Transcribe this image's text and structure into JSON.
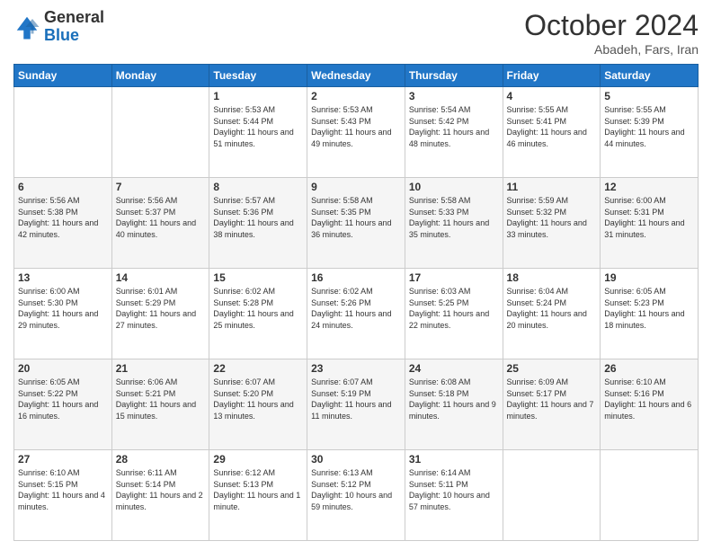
{
  "logo": {
    "general": "General",
    "blue": "Blue"
  },
  "header": {
    "month": "October 2024",
    "location": "Abadeh, Fars, Iran"
  },
  "weekdays": [
    "Sunday",
    "Monday",
    "Tuesday",
    "Wednesday",
    "Thursday",
    "Friday",
    "Saturday"
  ],
  "weeks": [
    [
      {
        "day": "",
        "info": ""
      },
      {
        "day": "",
        "info": ""
      },
      {
        "day": "1",
        "info": "Sunrise: 5:53 AM\nSunset: 5:44 PM\nDaylight: 11 hours and 51 minutes."
      },
      {
        "day": "2",
        "info": "Sunrise: 5:53 AM\nSunset: 5:43 PM\nDaylight: 11 hours and 49 minutes."
      },
      {
        "day": "3",
        "info": "Sunrise: 5:54 AM\nSunset: 5:42 PM\nDaylight: 11 hours and 48 minutes."
      },
      {
        "day": "4",
        "info": "Sunrise: 5:55 AM\nSunset: 5:41 PM\nDaylight: 11 hours and 46 minutes."
      },
      {
        "day": "5",
        "info": "Sunrise: 5:55 AM\nSunset: 5:39 PM\nDaylight: 11 hours and 44 minutes."
      }
    ],
    [
      {
        "day": "6",
        "info": "Sunrise: 5:56 AM\nSunset: 5:38 PM\nDaylight: 11 hours and 42 minutes."
      },
      {
        "day": "7",
        "info": "Sunrise: 5:56 AM\nSunset: 5:37 PM\nDaylight: 11 hours and 40 minutes."
      },
      {
        "day": "8",
        "info": "Sunrise: 5:57 AM\nSunset: 5:36 PM\nDaylight: 11 hours and 38 minutes."
      },
      {
        "day": "9",
        "info": "Sunrise: 5:58 AM\nSunset: 5:35 PM\nDaylight: 11 hours and 36 minutes."
      },
      {
        "day": "10",
        "info": "Sunrise: 5:58 AM\nSunset: 5:33 PM\nDaylight: 11 hours and 35 minutes."
      },
      {
        "day": "11",
        "info": "Sunrise: 5:59 AM\nSunset: 5:32 PM\nDaylight: 11 hours and 33 minutes."
      },
      {
        "day": "12",
        "info": "Sunrise: 6:00 AM\nSunset: 5:31 PM\nDaylight: 11 hours and 31 minutes."
      }
    ],
    [
      {
        "day": "13",
        "info": "Sunrise: 6:00 AM\nSunset: 5:30 PM\nDaylight: 11 hours and 29 minutes."
      },
      {
        "day": "14",
        "info": "Sunrise: 6:01 AM\nSunset: 5:29 PM\nDaylight: 11 hours and 27 minutes."
      },
      {
        "day": "15",
        "info": "Sunrise: 6:02 AM\nSunset: 5:28 PM\nDaylight: 11 hours and 25 minutes."
      },
      {
        "day": "16",
        "info": "Sunrise: 6:02 AM\nSunset: 5:26 PM\nDaylight: 11 hours and 24 minutes."
      },
      {
        "day": "17",
        "info": "Sunrise: 6:03 AM\nSunset: 5:25 PM\nDaylight: 11 hours and 22 minutes."
      },
      {
        "day": "18",
        "info": "Sunrise: 6:04 AM\nSunset: 5:24 PM\nDaylight: 11 hours and 20 minutes."
      },
      {
        "day": "19",
        "info": "Sunrise: 6:05 AM\nSunset: 5:23 PM\nDaylight: 11 hours and 18 minutes."
      }
    ],
    [
      {
        "day": "20",
        "info": "Sunrise: 6:05 AM\nSunset: 5:22 PM\nDaylight: 11 hours and 16 minutes."
      },
      {
        "day": "21",
        "info": "Sunrise: 6:06 AM\nSunset: 5:21 PM\nDaylight: 11 hours and 15 minutes."
      },
      {
        "day": "22",
        "info": "Sunrise: 6:07 AM\nSunset: 5:20 PM\nDaylight: 11 hours and 13 minutes."
      },
      {
        "day": "23",
        "info": "Sunrise: 6:07 AM\nSunset: 5:19 PM\nDaylight: 11 hours and 11 minutes."
      },
      {
        "day": "24",
        "info": "Sunrise: 6:08 AM\nSunset: 5:18 PM\nDaylight: 11 hours and 9 minutes."
      },
      {
        "day": "25",
        "info": "Sunrise: 6:09 AM\nSunset: 5:17 PM\nDaylight: 11 hours and 7 minutes."
      },
      {
        "day": "26",
        "info": "Sunrise: 6:10 AM\nSunset: 5:16 PM\nDaylight: 11 hours and 6 minutes."
      }
    ],
    [
      {
        "day": "27",
        "info": "Sunrise: 6:10 AM\nSunset: 5:15 PM\nDaylight: 11 hours and 4 minutes."
      },
      {
        "day": "28",
        "info": "Sunrise: 6:11 AM\nSunset: 5:14 PM\nDaylight: 11 hours and 2 minutes."
      },
      {
        "day": "29",
        "info": "Sunrise: 6:12 AM\nSunset: 5:13 PM\nDaylight: 11 hours and 1 minute."
      },
      {
        "day": "30",
        "info": "Sunrise: 6:13 AM\nSunset: 5:12 PM\nDaylight: 10 hours and 59 minutes."
      },
      {
        "day": "31",
        "info": "Sunrise: 6:14 AM\nSunset: 5:11 PM\nDaylight: 10 hours and 57 minutes."
      },
      {
        "day": "",
        "info": ""
      },
      {
        "day": "",
        "info": ""
      }
    ]
  ]
}
